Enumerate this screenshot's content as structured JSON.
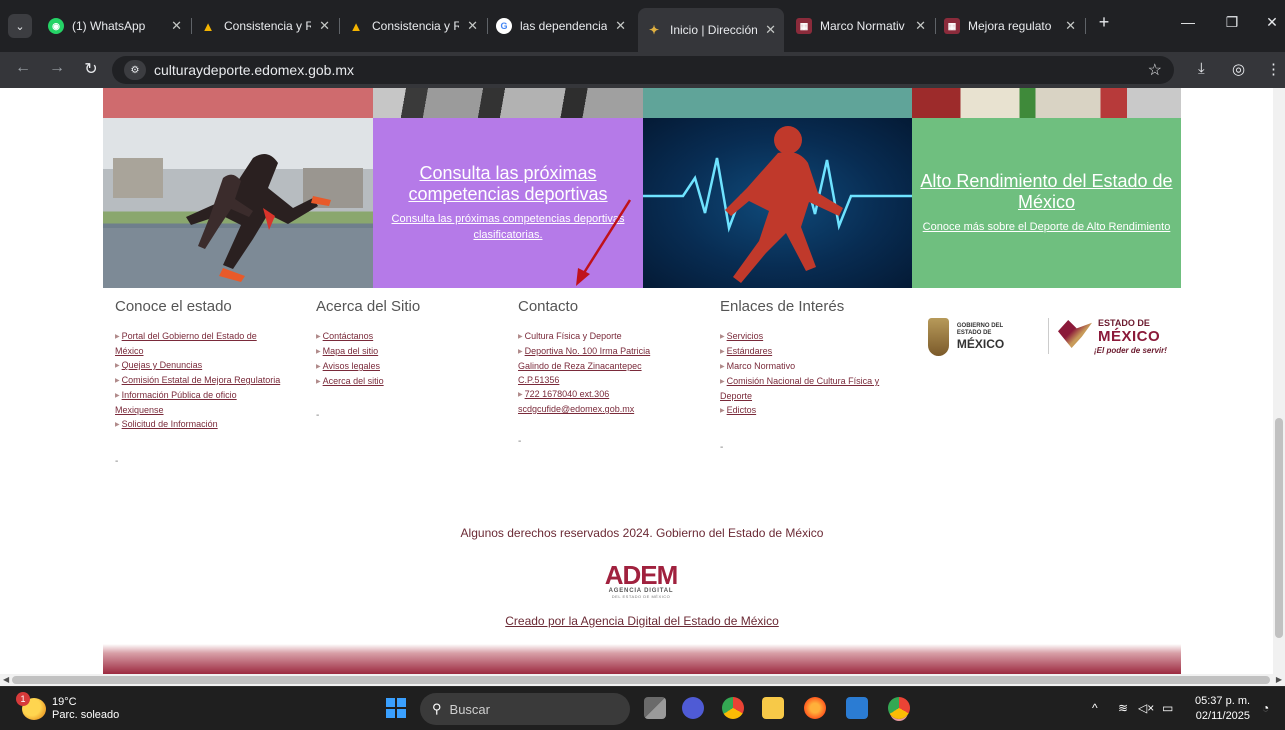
{
  "browser": {
    "tabs": [
      {
        "label": "(1) WhatsApp",
        "color": "#25d366",
        "glyph": "◉"
      },
      {
        "label": "Consistencia y R",
        "color": "#f4b400",
        "glyph": "▲"
      },
      {
        "label": "Consistencia y R",
        "color": "#f4b400",
        "glyph": "▲"
      },
      {
        "label": "las dependencia",
        "color": "#4285f4",
        "glyph": "G"
      },
      {
        "label": "Inicio | Dirección",
        "color": "#c8a040",
        "glyph": "✦"
      },
      {
        "label": "Marco Normativ",
        "color": "#8b2b3b",
        "glyph": "▦"
      },
      {
        "label": "Mejora regulato",
        "color": "#8b2b3b",
        "glyph": "▦"
      }
    ],
    "url": "culturaydeporte.edomex.gob.mx"
  },
  "cards": {
    "consulta_title": "Consulta las próximas competencias deportivas",
    "consulta_sub": "Consulta las próximas competencias deportivas clasificatorias.",
    "alto_title": "Alto Rendimiento del Estado de México",
    "alto_sub": "Conoce más sobre el Deporte de Alto Rendimiento"
  },
  "footer": {
    "conoce": {
      "title": "Conoce el estado",
      "links": [
        "Portal del Gobierno del Estado de México",
        "Quejas y Denuncias",
        "Comisión Estatal de Mejora Regulatoria",
        "Información Pública de oficio Mexiquense",
        "Solicitud de Información"
      ]
    },
    "acerca": {
      "title": "Acerca del Sitio",
      "links": [
        "Contáctanos",
        "Mapa del sitio",
        "Avisos legales",
        "Acerca del sitio"
      ]
    },
    "contacto": {
      "title": "Contacto",
      "links": [
        "Cultura Física y Deporte",
        "Deportiva No. 100 Irma Patricia Galindo de Reza Zinacantepec C.P.51356",
        "722 1678040 ext.306"
      ],
      "email": "scdgcufide@edomex.gob.mx"
    },
    "enlaces": {
      "title": "Enlaces de Interés",
      "links": [
        "Servicios",
        "Estándares",
        "Marco Normativo",
        "Comisión Nacional de Cultura Física y Deporte",
        "Edictos"
      ]
    },
    "logos": {
      "gob_small": "GOBIERNO DEL ESTADO DE",
      "gob_big": "MÉXICO",
      "edo_top": "ESTADO DE",
      "edo_main": "MÉXICO",
      "edo_slogan": "¡El poder de servir!"
    },
    "dash": "-",
    "copyright": "Algunos derechos reservados 2024. Gobierno del Estado de México",
    "adem_word": "ADEM",
    "adem_sub": "AGENCIA DIGITAL",
    "adem_sub2": "DEL ESTADO DE MÉXICO",
    "creado": "Creado por la Agencia Digital del Estado de México"
  },
  "taskbar": {
    "temp": "19°C",
    "weather": "Parc. soleado",
    "weather_badge": "1",
    "search": "Buscar",
    "time": "05:37 p. m.",
    "date": "02/11/2025"
  }
}
